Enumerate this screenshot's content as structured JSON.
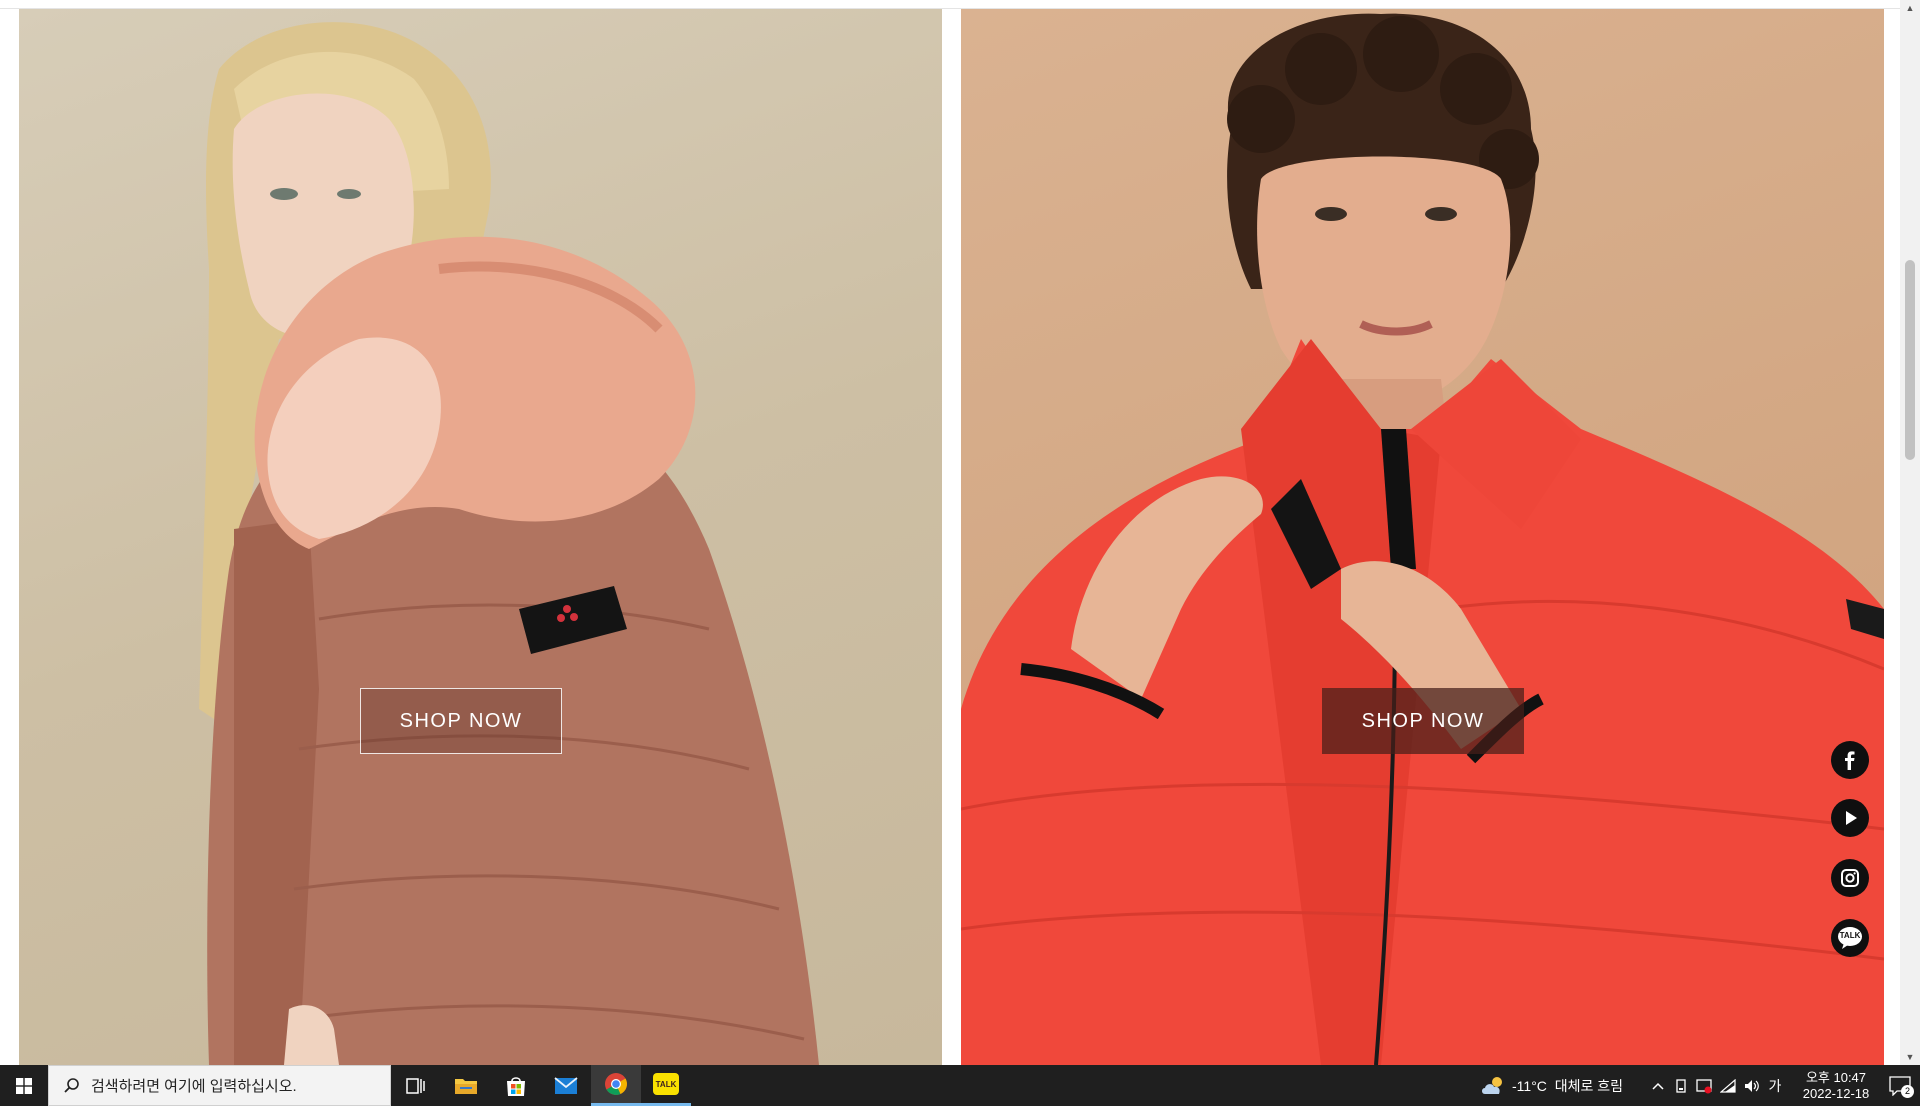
{
  "page": {
    "left_panel": {
      "shop_label": "SHOP NOW",
      "photo": "woman-pink-fur-down-jacket"
    },
    "right_panel": {
      "shop_label": "SHOP NOW",
      "photo": "man-red-down-jacket"
    }
  },
  "social": [
    {
      "name": "facebook-icon"
    },
    {
      "name": "youtube-icon"
    },
    {
      "name": "instagram-icon"
    },
    {
      "name": "kakaotalk-icon",
      "label": "TALK"
    }
  ],
  "taskbar": {
    "search_placeholder": "검색하려면 여기에 입력하십시오.",
    "apps": [
      "task-view-icon",
      "file-explorer-icon",
      "microsoft-store-icon",
      "mail-icon",
      "chrome-icon",
      "kakaotalk-app-icon"
    ],
    "kakao_label": "TALK",
    "weather": {
      "temp": "-11°C",
      "desc": "대체로 흐림"
    },
    "ime": "가",
    "clock": {
      "time": "오후 10:47",
      "date": "2022-12-18"
    },
    "notifications": "2"
  },
  "colors": {
    "left_bg": "#cfc3aa",
    "right_bg": "#d5a985",
    "jacket_left": "#b07360",
    "jacket_right": "#f0473b",
    "taskbar": "#1f1f1f"
  }
}
